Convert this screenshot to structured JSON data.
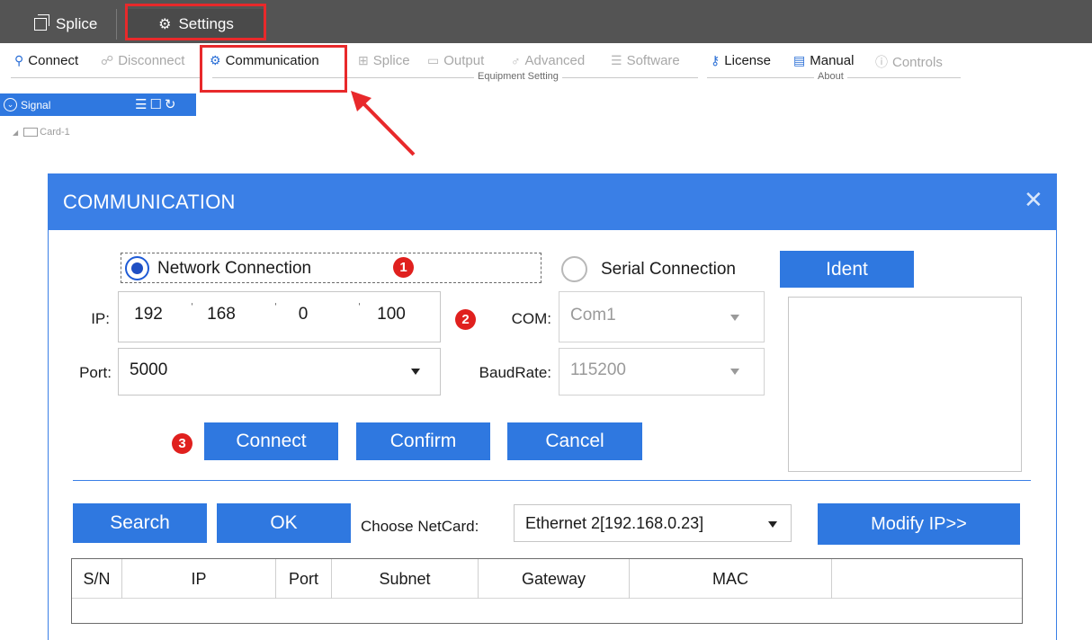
{
  "tabs": [
    {
      "label": "Splice",
      "icon": "window-icon"
    },
    {
      "label": "Settings",
      "icon": "gear-icon"
    }
  ],
  "ribbon": {
    "connect": "Connect",
    "disconnect": "Disconnect",
    "communication": "Communication",
    "splice": "Splice",
    "output": "Output",
    "advanced": "Advanced",
    "software": "Software",
    "license": "License",
    "manual": "Manual",
    "controls": "Controls",
    "group_equipment": "Equipment Setting",
    "group_about": "About"
  },
  "signal_panel": {
    "title": "Signal",
    "tree_item": "Card-1"
  },
  "dialog": {
    "title": "COMMUNICATION",
    "close": "✕",
    "network_radio": "Network Connection",
    "serial_radio": "Serial Connection",
    "ident_button": "Ident",
    "ip_label": "IP:",
    "ip": [
      "192",
      "168",
      "0",
      "100"
    ],
    "port_label": "Port:",
    "port_value": "5000",
    "com_label": "COM:",
    "com_value": "Com1",
    "baud_label": "BaudRate:",
    "baud_value": "115200",
    "connect_button": "Connect",
    "confirm_button": "Confirm",
    "cancel_button": "Cancel",
    "search_button": "Search",
    "ok_button": "OK",
    "netcard_label": "Choose NetCard:",
    "netcard_value": "Ethernet 2[192.168.0.23]",
    "modify_button": "Modify IP>>",
    "columns": [
      "S/N",
      "IP",
      "Port",
      "Subnet",
      "Gateway",
      "MAC"
    ]
  },
  "badges": [
    "1",
    "2",
    "3"
  ],
  "colors": {
    "accent": "#2f78e0",
    "title_bar": "#3a7fe6",
    "annotation_red": "#e8292b",
    "tab_bar": "#545454"
  }
}
